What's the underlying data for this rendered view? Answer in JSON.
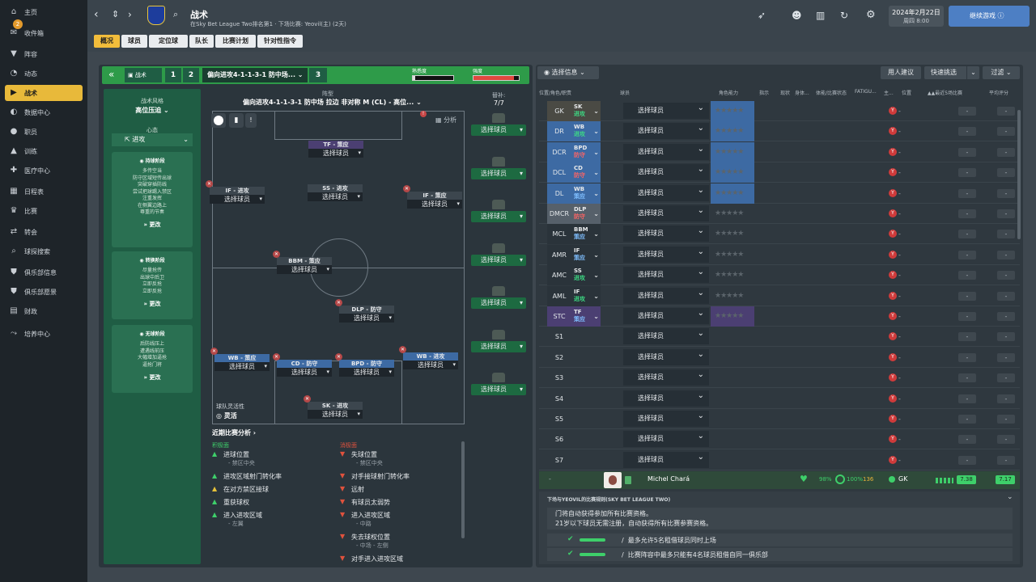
{
  "sidebar": {
    "items": [
      {
        "label": "主页",
        "icon": "home-icon",
        "glyph": "⌂"
      },
      {
        "label": "收件箱",
        "icon": "inbox-icon",
        "glyph": "✉",
        "badge": "2"
      },
      {
        "label": "阵容",
        "icon": "shirt-icon",
        "glyph": "▼"
      },
      {
        "label": "动态",
        "icon": "dynamics-icon",
        "glyph": "◔"
      },
      {
        "label": "战术",
        "icon": "tactics-icon",
        "glyph": "▶"
      },
      {
        "label": "数据中心",
        "icon": "data-icon",
        "glyph": "◐"
      },
      {
        "label": "职员",
        "icon": "staff-icon",
        "glyph": "●"
      },
      {
        "label": "训练",
        "icon": "training-icon",
        "glyph": "▲"
      },
      {
        "label": "医疗中心",
        "icon": "medical-icon",
        "glyph": "✚"
      },
      {
        "label": "日程表",
        "icon": "calendar-icon",
        "glyph": "▦"
      },
      {
        "label": "比赛",
        "icon": "trophy-icon",
        "glyph": "♛"
      },
      {
        "label": "转会",
        "icon": "transfer-icon",
        "glyph": "⇄"
      },
      {
        "label": "球探搜索",
        "icon": "scout-icon",
        "glyph": "⌕"
      },
      {
        "label": "俱乐部信息",
        "icon": "club-icon",
        "glyph": "⛊"
      },
      {
        "label": "俱乐部愿景",
        "icon": "vision-icon",
        "glyph": "⛊"
      },
      {
        "label": "财政",
        "icon": "finance-icon",
        "glyph": "▤"
      },
      {
        "label": "培养中心",
        "icon": "development-icon",
        "glyph": "⤳"
      }
    ]
  },
  "header": {
    "title": "战术",
    "subtitle": "在Sky Bet League Two排名第1 · 下场比赛: Yeovil(主) (2天)",
    "date": "2024年2月22日",
    "day_time": "周四 8:00",
    "continue": "继续游戏",
    "tabs": [
      "概况",
      "球员",
      "定位球",
      "队长",
      "比赛计划",
      "针对性指令"
    ]
  },
  "tactic_bar": {
    "label": "战术",
    "slot1": "1",
    "slot2": "2",
    "name": "偏向进攻4-1-1-3-1 防中场...",
    "slot3": "3",
    "familiarity_label": "熟悉度",
    "intensity_label": "强度",
    "familiarity_pct": 0.05,
    "intensity_pct": 0.9
  },
  "style_panel": {
    "title": "战术风格",
    "style": "高位压迫",
    "mentality_label": "心态",
    "mentality": "进攻",
    "in_possession_title": "持球阶段",
    "in_possession": [
      "多传空当",
      "防守区域短传出球",
      "突破穿插防线",
      "尝试把球踢入禁区",
      "注重发挥",
      "在侧翼边路上",
      "尊重的节奏"
    ],
    "transition_title": "转换阶段",
    "transition": [
      "尽量抢传",
      "出球中后卫",
      "立即反抢",
      "立即反抢"
    ],
    "out_possession_title": "无球阶段",
    "out_possession": [
      "后防线压上",
      "遭遇线前压",
      "大幅增加逼抢",
      "逼抢门将"
    ],
    "more": "更改"
  },
  "formation": {
    "label": "阵型",
    "name": "偏向进攻4-1-1-3-1 防中场 拉边 非对称 M (CL) - 高位...",
    "analysis": "分析",
    "subs_label": "替补:",
    "subs_count": "7/7",
    "select": "选择球员",
    "flex_label": "球队灵活性",
    "flex_value": "灵活",
    "players": [
      {
        "role": "TF - 策应",
        "style": "attack"
      },
      {
        "role": "IF - 进攻",
        "style": "sup"
      },
      {
        "role": "SS - 进攻",
        "style": "sup"
      },
      {
        "role": "IF - 策应",
        "style": "sup"
      },
      {
        "role": "BBM - 策应",
        "style": "sup"
      },
      {
        "role": "DLP - 防守",
        "style": "sup"
      },
      {
        "role": "WB - 策应",
        "style": "def"
      },
      {
        "role": "CD - 防守",
        "style": "def"
      },
      {
        "role": "BPD - 防守",
        "style": "def"
      },
      {
        "role": "WB - 进攻",
        "style": "def"
      },
      {
        "role": "SK - 进攻",
        "style": "sup"
      }
    ]
  },
  "analysis": {
    "title": "近期比赛分析",
    "positive_label": "积极面",
    "negative_label": "消极面",
    "positive": [
      {
        "t": "进球位置",
        "s": "- 禁区中央"
      },
      {
        "t": "进攻区域射门转化率",
        "s": ""
      },
      {
        "t": "在对方禁区接球",
        "s": ""
      },
      {
        "t": "重获球权",
        "s": ""
      },
      {
        "t": "进入进攻区域",
        "s": "- 左翼"
      }
    ],
    "negative": [
      {
        "t": "失球位置",
        "s": "- 禁区中央"
      },
      {
        "t": "对手接球射门转化率",
        "s": ""
      },
      {
        "t": "远射",
        "s": ""
      },
      {
        "t": "有球员太弱势",
        "s": ""
      },
      {
        "t": "进入进攻区域",
        "s": "- 中路"
      },
      {
        "t": "失去球权位置",
        "s": "- 中场 - 左侧"
      },
      {
        "t": "对手进入进攻区域",
        "s": ""
      }
    ]
  },
  "right": {
    "info_btn": "选择信息",
    "advice_btn": "用人建议",
    "quick_btn": "快速挑选",
    "filter_btn": "过滤",
    "cols": [
      "位置/角色/职责",
      "球员",
      "角色能力",
      "指示",
      "现状",
      "身体...",
      "体能/比赛状态",
      "FATIGU...",
      "主...",
      "位置",
      "▲▲最近5场比赛",
      "平均评分"
    ],
    "rows": [
      {
        "pos": "GK",
        "r1": "SK",
        "r2": "进攻",
        "c": "#4a4a44",
        "r2c": "#3ddc84"
      },
      {
        "pos": "DR",
        "r1": "WB",
        "r2": "进攻",
        "c": "#3d6aa3",
        "r2c": "#3ddc84"
      },
      {
        "pos": "DCR",
        "r1": "BPD",
        "r2": "防守",
        "c": "#3d6aa3",
        "r2c": "#ff6464"
      },
      {
        "pos": "DCL",
        "r1": "CD",
        "r2": "防守",
        "c": "#3d6aa3",
        "r2c": "#ff6464"
      },
      {
        "pos": "DL",
        "r1": "WB",
        "r2": "策应",
        "c": "#3d6aa3",
        "r2c": "#7fbfff"
      },
      {
        "pos": "DMCR",
        "r1": "DLP",
        "r2": "防守",
        "c": "#56606a",
        "r2c": "#ff6464"
      },
      {
        "pos": "MCL",
        "r1": "BBM",
        "r2": "策应",
        "c": "#2a333a",
        "r2c": "#7fbfff"
      },
      {
        "pos": "AMR",
        "r1": "IF",
        "r2": "策应",
        "c": "#2a333a",
        "r2c": "#7fbfff"
      },
      {
        "pos": "AMC",
        "r1": "SS",
        "r2": "进攻",
        "c": "#2a333a",
        "r2c": "#3ddc84"
      },
      {
        "pos": "AML",
        "r1": "IF",
        "r2": "进攻",
        "c": "#2a333a",
        "r2c": "#3ddc84"
      },
      {
        "pos": "STC",
        "r1": "TF",
        "r2": "策应",
        "c": "#4b3f72",
        "r2c": "#7fbfff"
      },
      {
        "pos": "S1",
        "r1": "",
        "r2": "",
        "c": "",
        "r2c": ""
      },
      {
        "pos": "S2",
        "r1": "",
        "r2": "",
        "c": "",
        "r2c": ""
      },
      {
        "pos": "S3",
        "r1": "",
        "r2": "",
        "c": "",
        "r2c": ""
      },
      {
        "pos": "S4",
        "r1": "",
        "r2": "",
        "c": "",
        "r2c": ""
      },
      {
        "pos": "S5",
        "r1": "",
        "r2": "",
        "c": "",
        "r2c": ""
      },
      {
        "pos": "S6",
        "r1": "",
        "r2": "",
        "c": "",
        "r2c": ""
      },
      {
        "pos": "S7",
        "r1": "",
        "r2": "",
        "c": "",
        "r2c": ""
      }
    ],
    "select": "选择球员",
    "dash": "-",
    "y": "Y",
    "player": {
      "name": "Michel Chará",
      "cond": "98%",
      "sharp": "100%",
      "num": "136",
      "pos": "GK",
      "rating1": "7.38",
      "rating2": "7.17"
    },
    "next_match": "下场与YEOVIL的比赛规则(SKY BET LEAGUE TWO)",
    "rules": [
      "门将自动获得参加所有比赛资格。",
      "21岁以下球员无需注册，自动获得所有比赛参赛资格。"
    ],
    "rule_checks": [
      "最多允许5名租借球员同时上场",
      "比赛阵容中最多只能有4名球员租借自同一俱乐部"
    ]
  }
}
